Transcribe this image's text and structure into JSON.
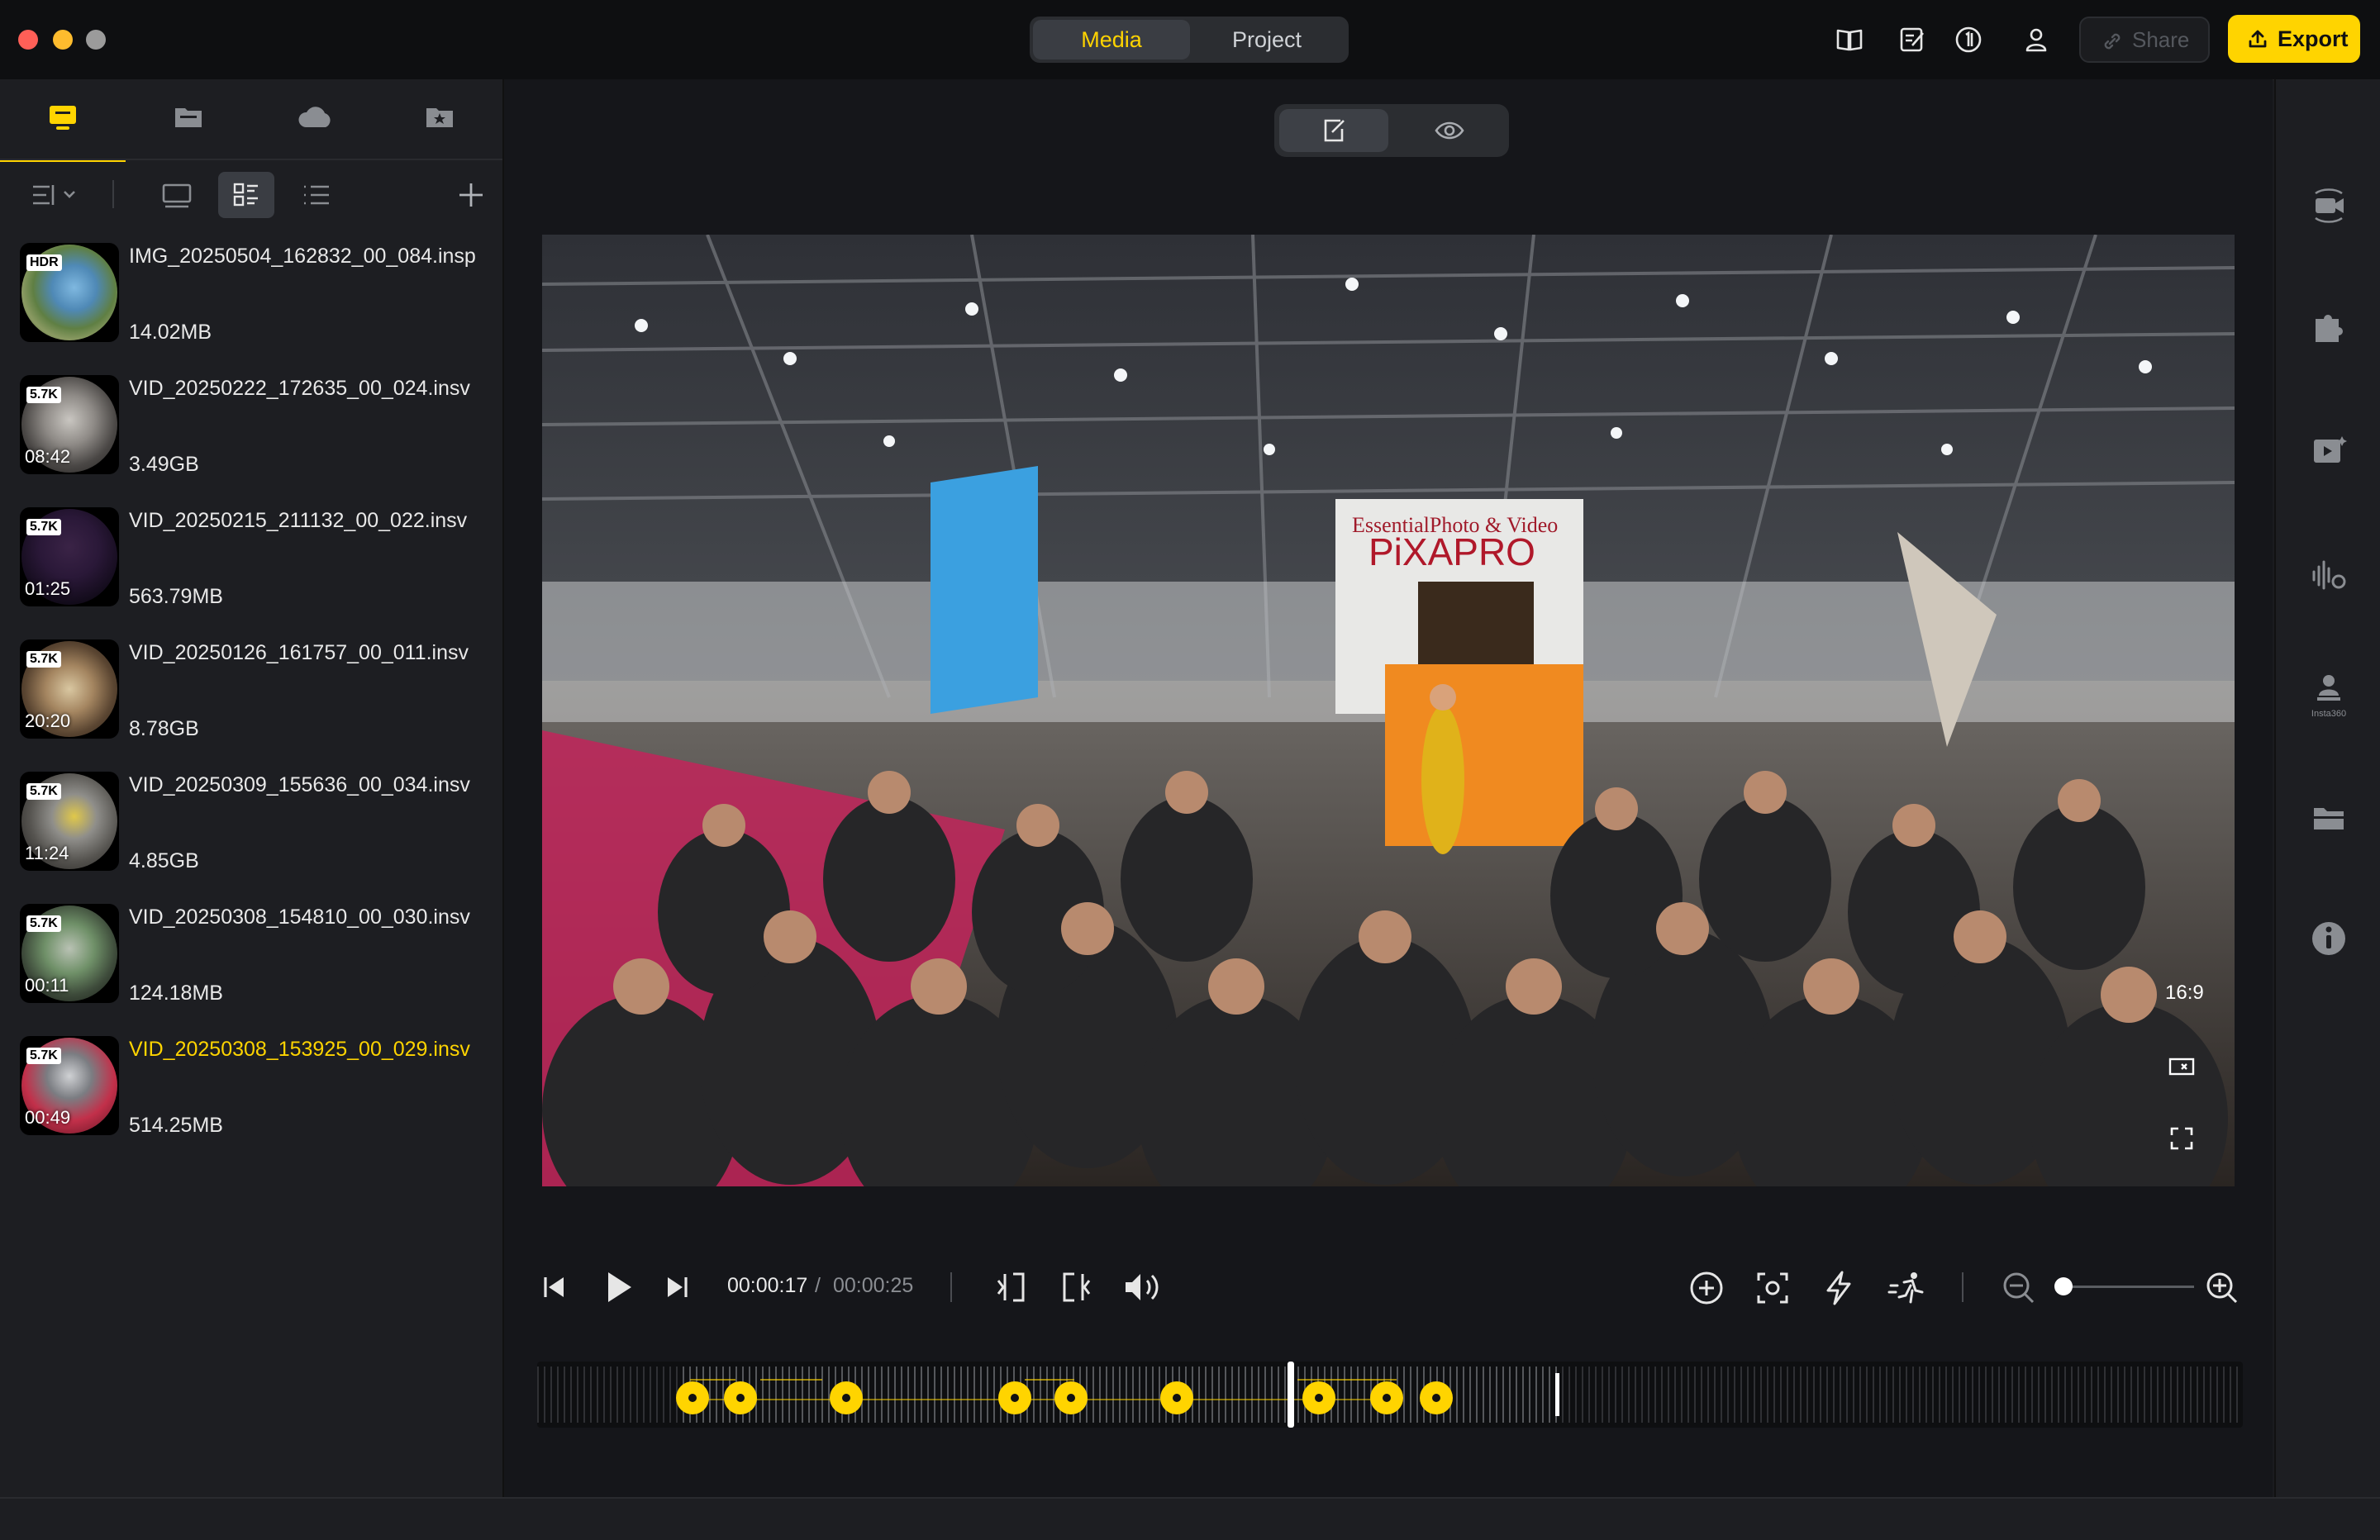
{
  "titlebar": {
    "tabs": [
      {
        "label": "Media",
        "active": true
      },
      {
        "label": "Project",
        "active": false
      }
    ],
    "share_label": "Share",
    "export_label": "Export",
    "accent": "#ffd400"
  },
  "sidebar": {
    "source_tabs": [
      "local-computer-icon",
      "folder-icon",
      "cloud-icon",
      "favorites-icon"
    ],
    "view_controls": [
      "sort-icon",
      "large-view-icon",
      "grid-view-icon",
      "list-view-icon",
      "add-icon"
    ],
    "items": [
      {
        "name": "IMG_20250504_162832_00_084.insp",
        "size": "14.02MB",
        "badge": "HDR",
        "duration": "",
        "selected": false
      },
      {
        "name": "VID_20250222_172635_00_024.insv",
        "size": "3.49GB",
        "badge": "5.7K",
        "duration": "08:42",
        "selected": false
      },
      {
        "name": "VID_20250215_211132_00_022.insv",
        "size": "563.79MB",
        "badge": "5.7K",
        "duration": "01:25",
        "selected": false
      },
      {
        "name": "VID_20250126_161757_00_011.insv",
        "size": "8.78GB",
        "badge": "5.7K",
        "duration": "20:20",
        "selected": false
      },
      {
        "name": "VID_20250309_155636_00_034.insv",
        "size": "4.85GB",
        "badge": "5.7K",
        "duration": "11:24",
        "selected": false
      },
      {
        "name": "VID_20250308_154810_00_030.insv",
        "size": "124.18MB",
        "badge": "5.7K",
        "duration": "00:11",
        "selected": false
      },
      {
        "name": "VID_20250308_153925_00_029.insv",
        "size": "514.25MB",
        "badge": "5.7K",
        "duration": "00:49",
        "selected": true
      }
    ]
  },
  "preview": {
    "aspect_ratio": "16:9",
    "booth_sign_top": "EssentialPhoto & Video",
    "booth_sign": "PiXAPRO"
  },
  "playback": {
    "current_time": "00:00:17",
    "separator": "/",
    "total_time": "00:00:25"
  },
  "timeline": {
    "keyframe_count": 9,
    "playhead_fraction": 0.44
  },
  "right_panel": {
    "icons": [
      "camera-track-icon",
      "plugin-icon",
      "ai-edit-icon",
      "audio-settings-icon",
      "insta360-icon",
      "folder-icon",
      "info-icon"
    ],
    "insta_label": "Insta360"
  }
}
